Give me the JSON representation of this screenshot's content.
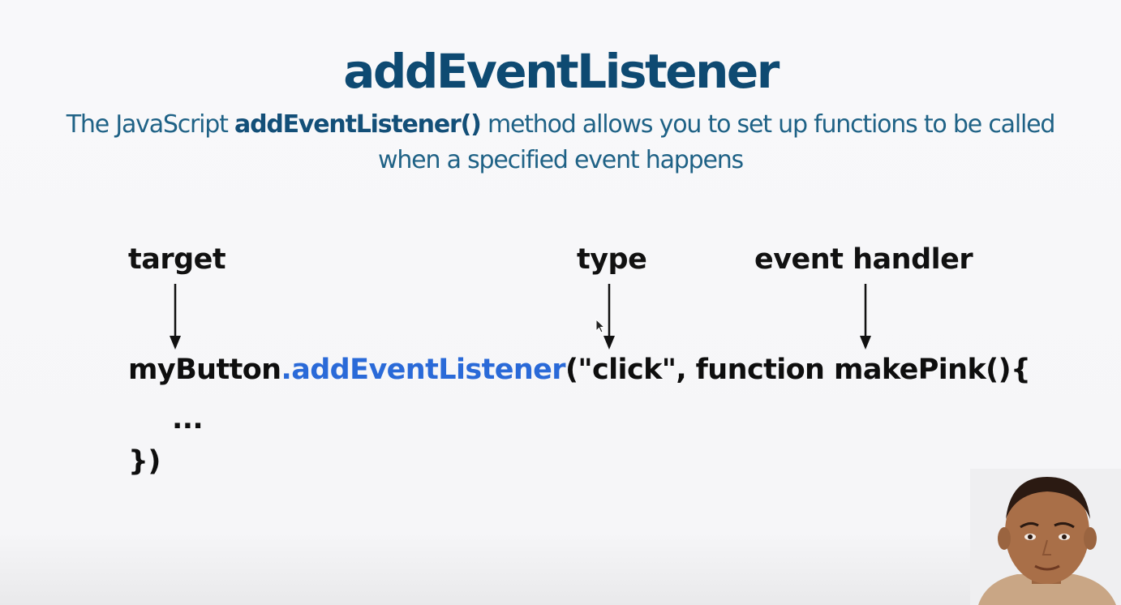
{
  "slide": {
    "title": "addEventListener",
    "subtitle": {
      "prefix": "The JavaScript ",
      "method": "addEventListener()",
      "middle": " method allows you to set up functions to be called",
      "line2": "when a specified event happens"
    }
  },
  "labels": {
    "target": "target",
    "type": "type",
    "event_handler": "event handler"
  },
  "code": {
    "line1": {
      "object": "myButton",
      "method": ".addEventListener",
      "args": "(\"click\", function makePink(){"
    },
    "line2": "...",
    "line3": "})"
  },
  "colors": {
    "title": "#0e4a72",
    "subtitle": "#1f6286",
    "method_highlight": "#2a6ad8",
    "code_text": "#0e0e0e"
  },
  "icons": [
    "down-arrow-icon",
    "mouse-cursor-icon"
  ]
}
